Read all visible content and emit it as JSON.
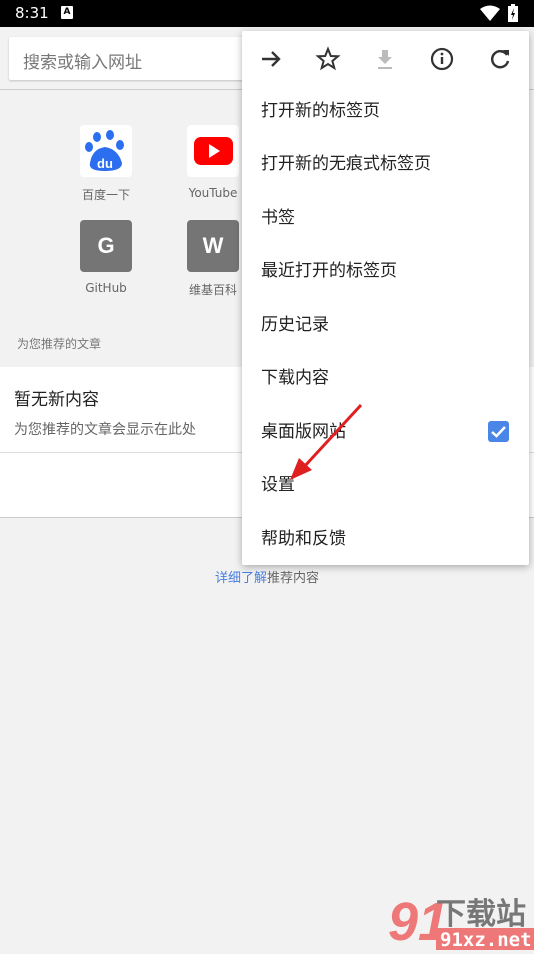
{
  "status_bar": {
    "time": "8:31"
  },
  "search": {
    "placeholder": "搜索或输入网址"
  },
  "tiles": [
    {
      "label": "百度一下",
      "icon": "baidu-logo"
    },
    {
      "label": "YouTube",
      "icon": "youtube-logo"
    },
    {
      "label": "GitHub",
      "letter": "G"
    },
    {
      "label": "维基百科",
      "letter": "W"
    }
  ],
  "feed": {
    "section_label": "为您推荐的文章",
    "card_title": "暂无新内容",
    "card_subtitle": "为您推荐的文章会显示在此处",
    "learn_link": "详细了解",
    "learn_rest": "推荐内容"
  },
  "menu": {
    "icons": [
      "forward-icon",
      "star-icon",
      "download-icon",
      "info-icon",
      "reload-icon"
    ],
    "items": [
      "打开新的标签页",
      "打开新的无痕式标签页",
      "书签",
      "最近打开的标签页",
      "历史记录",
      "下载内容",
      "桌面版网站",
      "设置",
      "帮助和反馈"
    ],
    "desktop_site_checked": true
  },
  "colors": {
    "accent": "#4a86e8",
    "annotation_arrow": "#e02020"
  },
  "watermark": {
    "text": "下载站",
    "domain": "91xz.net",
    "number": "91"
  }
}
